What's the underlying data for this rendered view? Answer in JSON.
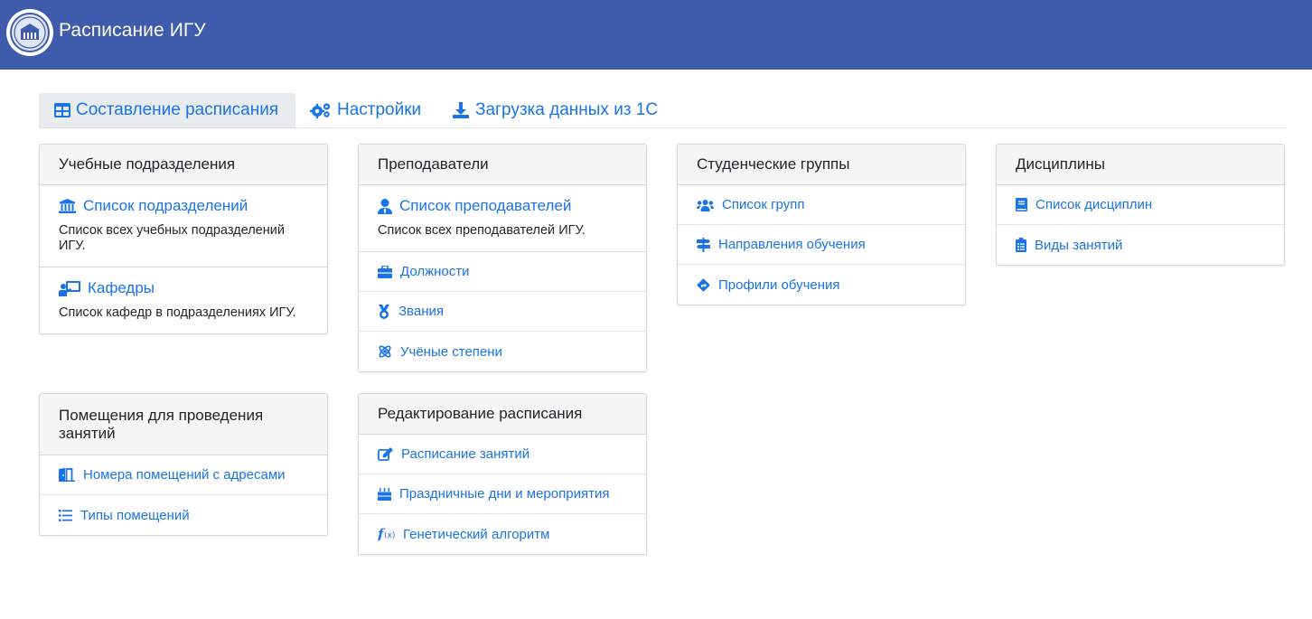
{
  "header": {
    "title": "Расписание ИГУ",
    "logo_icon": "university-seal-icon"
  },
  "tabs": [
    {
      "label": "Составление расписания",
      "icon": "table-icon",
      "active": true
    },
    {
      "label": "Настройки",
      "icon": "cogs-icon"
    },
    {
      "label": "Загрузка данных из 1С",
      "icon": "download-icon"
    }
  ],
  "cards": {
    "divisions": {
      "header": "Учебные подразделения",
      "big_items": [
        {
          "title": "Список подразделений",
          "desc": "Список всех учебных подразделений ИГУ.",
          "icon": "university-icon"
        },
        {
          "title": "Кафедры",
          "desc": "Список кафедр в подразделениях ИГУ.",
          "icon": "chalkboard-teacher-icon"
        }
      ]
    },
    "teachers": {
      "header": "Преподаватели",
      "big_items": [
        {
          "title": "Список преподавателей",
          "desc": "Список всех преподавателей ИГУ.",
          "icon": "user-tie-icon"
        }
      ],
      "items": [
        {
          "label": "Должности",
          "icon": "briefcase-icon"
        },
        {
          "label": "Звания",
          "icon": "medal-icon"
        },
        {
          "label": "Учёные степени",
          "icon": "atom-icon"
        }
      ]
    },
    "groups": {
      "header": "Студенческие группы",
      "items": [
        {
          "label": "Список групп",
          "icon": "users-icon"
        },
        {
          "label": "Направления обучения",
          "icon": "signs-icon"
        },
        {
          "label": "Профили обучения",
          "icon": "directions-icon"
        }
      ]
    },
    "disciplines": {
      "header": "Дисциплины",
      "items": [
        {
          "label": "Список дисциплин",
          "icon": "book-icon"
        },
        {
          "label": "Виды занятий",
          "icon": "clipboard-list-icon"
        }
      ]
    },
    "rooms": {
      "header": "Помещения для проведения занятий",
      "items": [
        {
          "label": "Номера помещений с адресами",
          "icon": "door-open-icon"
        },
        {
          "label": "Типы помещений",
          "icon": "list-icon"
        }
      ]
    },
    "editing": {
      "header": "Редактирование расписания",
      "items": [
        {
          "label": "Расписание занятий",
          "icon": "edit-icon"
        },
        {
          "label": "Праздничные дни и мероприятия",
          "icon": "birthday-cake-icon"
        },
        {
          "label": "Генетический алгоритм",
          "icon": "function-icon"
        }
      ]
    }
  },
  "colors": {
    "navbar": "#3f5bab",
    "link": "#1a73e8",
    "header_bg": "#f5f5f5"
  }
}
